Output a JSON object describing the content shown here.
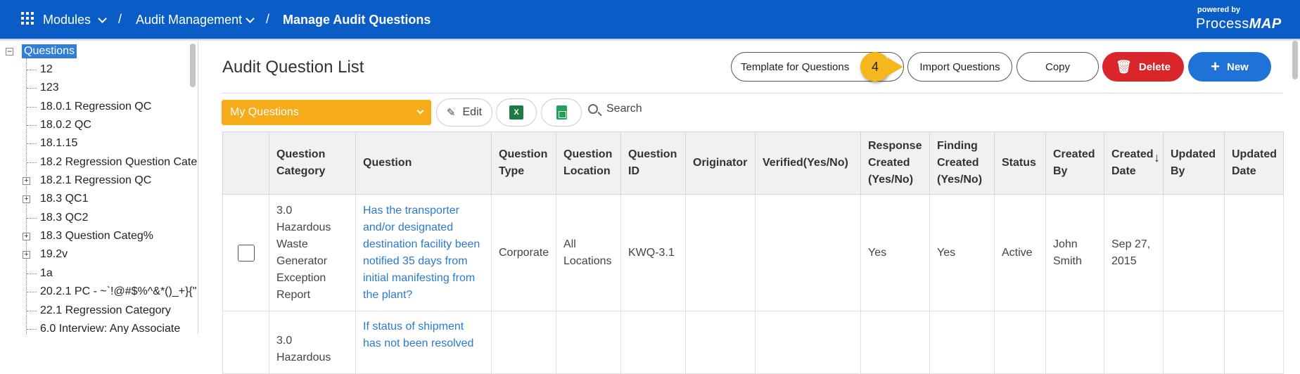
{
  "topbar": {
    "breadcrumbs": [
      "Modules",
      "Audit Management",
      "Manage Audit Questions"
    ],
    "separator": "/",
    "logo_top": "powered by",
    "logo_process": "Process",
    "logo_map": "MAP"
  },
  "sidebar": {
    "root": "Questions",
    "items": [
      "12",
      "123",
      "18.0.1 Regression QC",
      "18.0.2 QC",
      "18.1.15",
      "18.2 Regression Question Cate",
      "18.2.1 Regression QC",
      "18.3 QC1",
      "18.3 QC2",
      "18.3 Question Categ%",
      "19.2v",
      "1a",
      "20.2.1 PC - ~`!@#$%^&*()_+}{\"",
      "22.1 Regression Category",
      "6.0 Interview: Any Associate"
    ]
  },
  "main": {
    "title": "Audit Question List",
    "buttons": {
      "template": "Template for Questions",
      "import": "Import Questions",
      "copy": "Copy",
      "delete": "Delete",
      "new": "New"
    },
    "step_badge": "4",
    "filter_value": "My Questions",
    "edit_label": "Edit",
    "excel_icon_text": "X",
    "search_label": "Search"
  },
  "table": {
    "headers": [
      "",
      "Question Category",
      "Question",
      "Question Type",
      "Question Location",
      "Question ID",
      "Originator",
      "Verified(Yes/No)",
      "Response Created (Yes/No)",
      "Finding Created (Yes/No)",
      "Status",
      "Created By",
      "Created Date",
      "Updated By",
      "Updated Date"
    ],
    "sort_icon": "↓",
    "rows": [
      [
        "",
        "3.0 Hazardous Waste Generator Exception Report",
        "Has the transporter and/or designated destination facility been notified 35 days from initial manifesting from the plant?",
        "Corporate",
        "All Locations",
        "KWQ-3.1",
        "",
        "",
        "Yes",
        "Yes",
        "Active",
        "John Smith",
        "Sep 27, 2015",
        "",
        ""
      ],
      [
        "",
        "3.0 Hazardous",
        "If status of shipment has not been resolved",
        "",
        "",
        "",
        "",
        "",
        "",
        "",
        "",
        "",
        "",
        "",
        ""
      ]
    ]
  }
}
